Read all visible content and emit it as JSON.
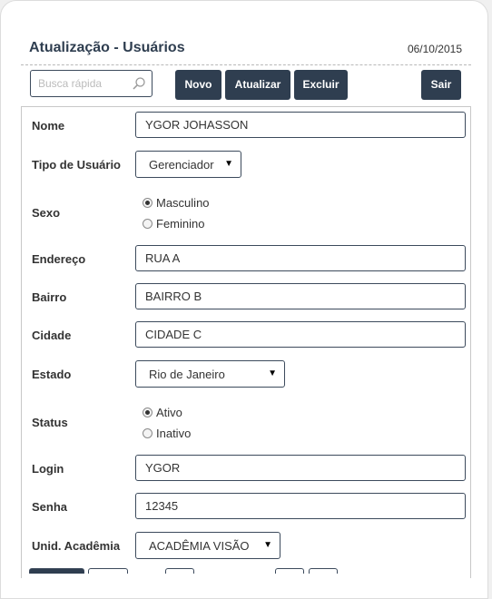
{
  "header": {
    "title": "Atualização - Usuários",
    "date": "06/10/2015"
  },
  "toolbar": {
    "search_placeholder": "Busca rápida",
    "novo_label": "Novo",
    "atualizar_label": "Atualizar",
    "excluir_label": "Excluir",
    "sair_label": "Sair"
  },
  "form": {
    "nome": {
      "label": "Nome",
      "value": "YGOR JOHASSON"
    },
    "tipo_usuario": {
      "label": "Tipo de Usuário",
      "value": "Gerenciador"
    },
    "sexo": {
      "label": "Sexo",
      "options": [
        "Masculino",
        "Feminino"
      ],
      "selected": "Masculino"
    },
    "endereco": {
      "label": "Endereço",
      "value": "RUA A"
    },
    "bairro": {
      "label": "Bairro",
      "value": "BAIRRO B"
    },
    "cidade": {
      "label": "Cidade",
      "value": "CIDADE C"
    },
    "estado": {
      "label": "Estado",
      "value": "Rio de Janeiro"
    },
    "status": {
      "label": "Status",
      "options": [
        "Ativo",
        "Inativo"
      ],
      "selected": "Ativo"
    },
    "login": {
      "label": "Login",
      "value": "YGOR"
    },
    "senha": {
      "label": "Senha",
      "value": "12345"
    },
    "unid_academia": {
      "label": "Unid. Acadêmia",
      "value": "ACADÊMIA VISÃO"
    }
  },
  "colors": {
    "button_bg": "#2f3e50",
    "border": "#3c4a5c"
  }
}
